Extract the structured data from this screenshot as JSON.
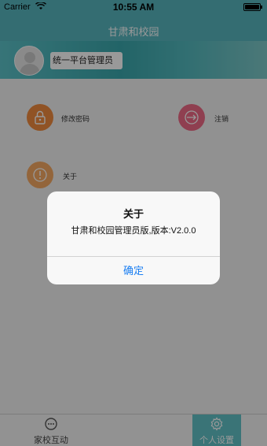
{
  "status_bar": {
    "carrier": "Carrier",
    "time": "10:55 AM"
  },
  "nav_bar": {
    "title": "甘肃和校园"
  },
  "profile": {
    "user_name": "统一平台管理员"
  },
  "menu": {
    "change_password": "修改密码",
    "logout": "注销",
    "about": "关于"
  },
  "tab_bar": {
    "home_label": "家校互动",
    "settings_label": "个人设置",
    "active": "个人设置"
  },
  "alert": {
    "title": "关于",
    "message": "甘肃和校园管理员版,版本:V2.0.0",
    "confirm": "确定"
  },
  "colors": {
    "brand": "#57b6bf",
    "password_icon": "#f08a3e",
    "logout_icon": "#ee6a85",
    "about_icon": "#f5a963",
    "alert_button": "#1a7ef2"
  }
}
